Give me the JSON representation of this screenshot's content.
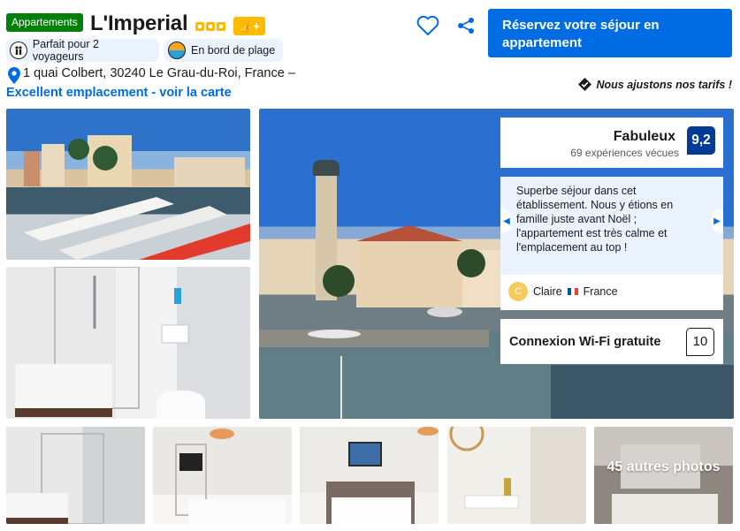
{
  "header": {
    "property_type": "Appartements",
    "name": "L'Imperial",
    "square_rating": 3,
    "thumbs_badge": "👍+",
    "facilities": [
      {
        "label": "Parfait pour 2 voyageurs",
        "icon": "people-icon"
      },
      {
        "label": "En bord de plage",
        "icon": "beach-icon"
      }
    ],
    "address": "1 quai Colbert, 30240 Le Grau-du-Roi, France –",
    "map_link": "Excellent emplacement - voir la carte",
    "price_note": "Nous ajustons nos tarifs !",
    "reserve_button": "Réservez votre séjour en appartement"
  },
  "colors": {
    "brand_blue": "#006ce4",
    "score_navy": "#003b95",
    "badge_green": "#008009",
    "star_yellow": "#febb02",
    "chip_bg": "#ebf3ff"
  },
  "gallery": {
    "more_photos": "45 autres photos"
  },
  "rating": {
    "label": "Fabuleux",
    "subtext": "69 expériences vécues",
    "score": "9,2"
  },
  "review": {
    "text": "Superbe séjour dans cet établissement. Nous y étions en famille juste avant Noël ; l'appartement est très calme et l'emplacement au top !",
    "avatar_letter": "C",
    "reviewer_name": "Claire",
    "country": "France"
  },
  "wifi": {
    "label": "Connexion Wi-Fi gratuite",
    "score": "10"
  }
}
